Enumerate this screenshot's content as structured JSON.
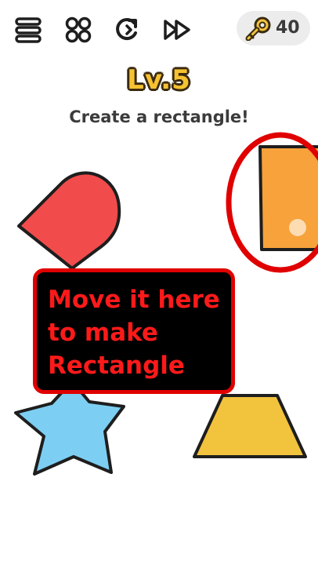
{
  "toolbar": {
    "buttons": [
      {
        "name": "menu",
        "icon": "menu-icon"
      },
      {
        "name": "grid",
        "icon": "grid-icon"
      },
      {
        "name": "hint",
        "icon": "hint-refresh-icon"
      },
      {
        "name": "skip",
        "icon": "fast-forward-icon"
      }
    ],
    "keys": {
      "icon": "key-icon",
      "count": "40"
    }
  },
  "level": {
    "title": "Lv.5",
    "question": "Create a rectangle!"
  },
  "shapes": [
    {
      "name": "red-rounded-shape",
      "color": "#f24b4b"
    },
    {
      "name": "orange-rectangle-piece",
      "color": "#f7a23a"
    },
    {
      "name": "blue-star",
      "color": "#7ccff2"
    },
    {
      "name": "yellow-trapezoid",
      "color": "#f2c33c"
    }
  ],
  "annotation": {
    "lines": [
      "Move it here",
      "to make",
      "Rectangle"
    ],
    "text_color": "#ff1a1a",
    "border_color": "#e00000",
    "circle_color": "#e00000"
  },
  "colors": {
    "background": "#ffffff",
    "level_title": "#f6c231",
    "outline": "#1e1e1e"
  }
}
